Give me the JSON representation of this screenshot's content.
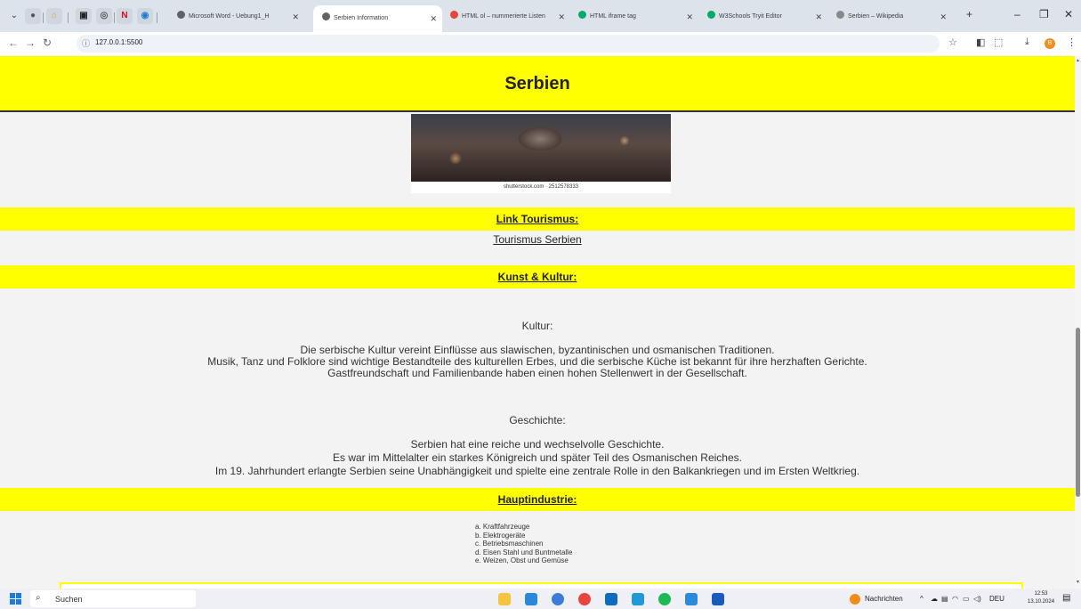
{
  "browser": {
    "tabs": [
      {
        "label": "Microsoft Word - Uebung1_H",
        "active": false
      },
      {
        "label": "Serbien Information",
        "active": true
      },
      {
        "label": "HTML ol – nummerierte Listen",
        "active": false
      },
      {
        "label": "HTML iframe tag",
        "active": false
      },
      {
        "label": "W3Schools Tryit Editor",
        "active": false
      },
      {
        "label": "Serbien – Wikipedia",
        "active": false
      }
    ],
    "url": "127.0.0.1:5500",
    "profile_initial": "B"
  },
  "page": {
    "title": "Serbien",
    "photo_credit": "shutterstock.com · 2512578333",
    "link_heading": "Link Tourismus:",
    "link_text": "Tourismus Serbien",
    "culture_heading": "Kunst & Kultur:",
    "culture_title": "Kultur:",
    "culture_lines": [
      "Die serbische Kultur vereint Einflüsse aus slawischen, byzantinischen und osmanischen Traditionen.",
      "Musik, Tanz und Folklore sind wichtige Bestandteile des kulturellen Erbes, und die serbische Küche ist bekannt für ihre herzhaften Gerichte.",
      "Gastfreundschaft und Familienbande haben einen hohen Stellenwert in der Gesellschaft."
    ],
    "history_title": "Geschichte:",
    "history_lines": [
      "Serbien hat eine reiche und wechselvolle Geschichte.",
      "Es war im Mittelalter ein starkes Königreich und später Teil des Osmanischen Reiches.",
      "Im 19. Jahrhundert erlangte Serbien seine Unabhängigkeit und spielte eine zentrale Rolle in den Balkankriegen und im Ersten Weltkrieg."
    ],
    "industry_heading": "Hauptindustrie:",
    "industry_items": [
      "a. Kraftfahrzeuge",
      "b. Elektrogeräte",
      "c. Betriebsmaschinen",
      "d. Eisen Stahl und Buntmetalle",
      "e. Weizen, Obst und Gemüse"
    ]
  },
  "taskbar": {
    "search_placeholder": "Suchen",
    "news_label": "Nachrichten",
    "language": "DEU",
    "time": "12:53",
    "date": "13.10.2024"
  },
  "colors": {
    "band": "#ffff00",
    "page_bg": "#f3f3f3",
    "accent_blue": "#1d7cd6"
  }
}
